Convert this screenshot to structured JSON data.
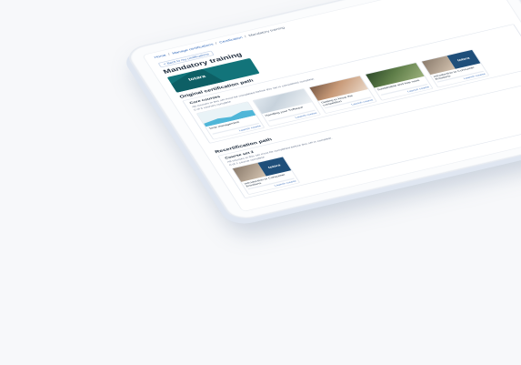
{
  "breadcrumb": [
    "Home",
    "Manage certifications",
    "Certification",
    "Mandatory training"
  ],
  "back_label": "< Back to my certifications",
  "title": "Mandatory training",
  "hero_logo": "totara",
  "sections": [
    {
      "title": "Original certification path",
      "sets": [
        {
          "title": "Core courses",
          "note": "All courses in this set must be completed before this set is considered complete.",
          "count": "0 of 6 courses complete",
          "courses": [
            {
              "title": "Time management",
              "image": "chart",
              "launch": "Launch course"
            },
            {
              "title": "Handling your Software",
              "image": "lab",
              "launch": "Launch course"
            },
            {
              "title": "Getting to know the competition",
              "image": "meeting",
              "launch": "Launch course"
            },
            {
              "title": "Sustainable and free work",
              "image": "garden",
              "launch": "Launch course"
            },
            {
              "title": "Introduction to Consumer Emotions",
              "image": "mixed",
              "launch": "Launch course"
            }
          ]
        }
      ]
    },
    {
      "title": "Recertification path",
      "sets": [
        {
          "title": "Course set 2",
          "note": "All courses in this set must be completed before this set is complete.",
          "count": "0 of 1 course complete",
          "courses": [
            {
              "title": "Introduction to Consumer Emotions",
              "image": "mixed",
              "launch": "Launch course"
            }
          ]
        }
      ]
    }
  ]
}
